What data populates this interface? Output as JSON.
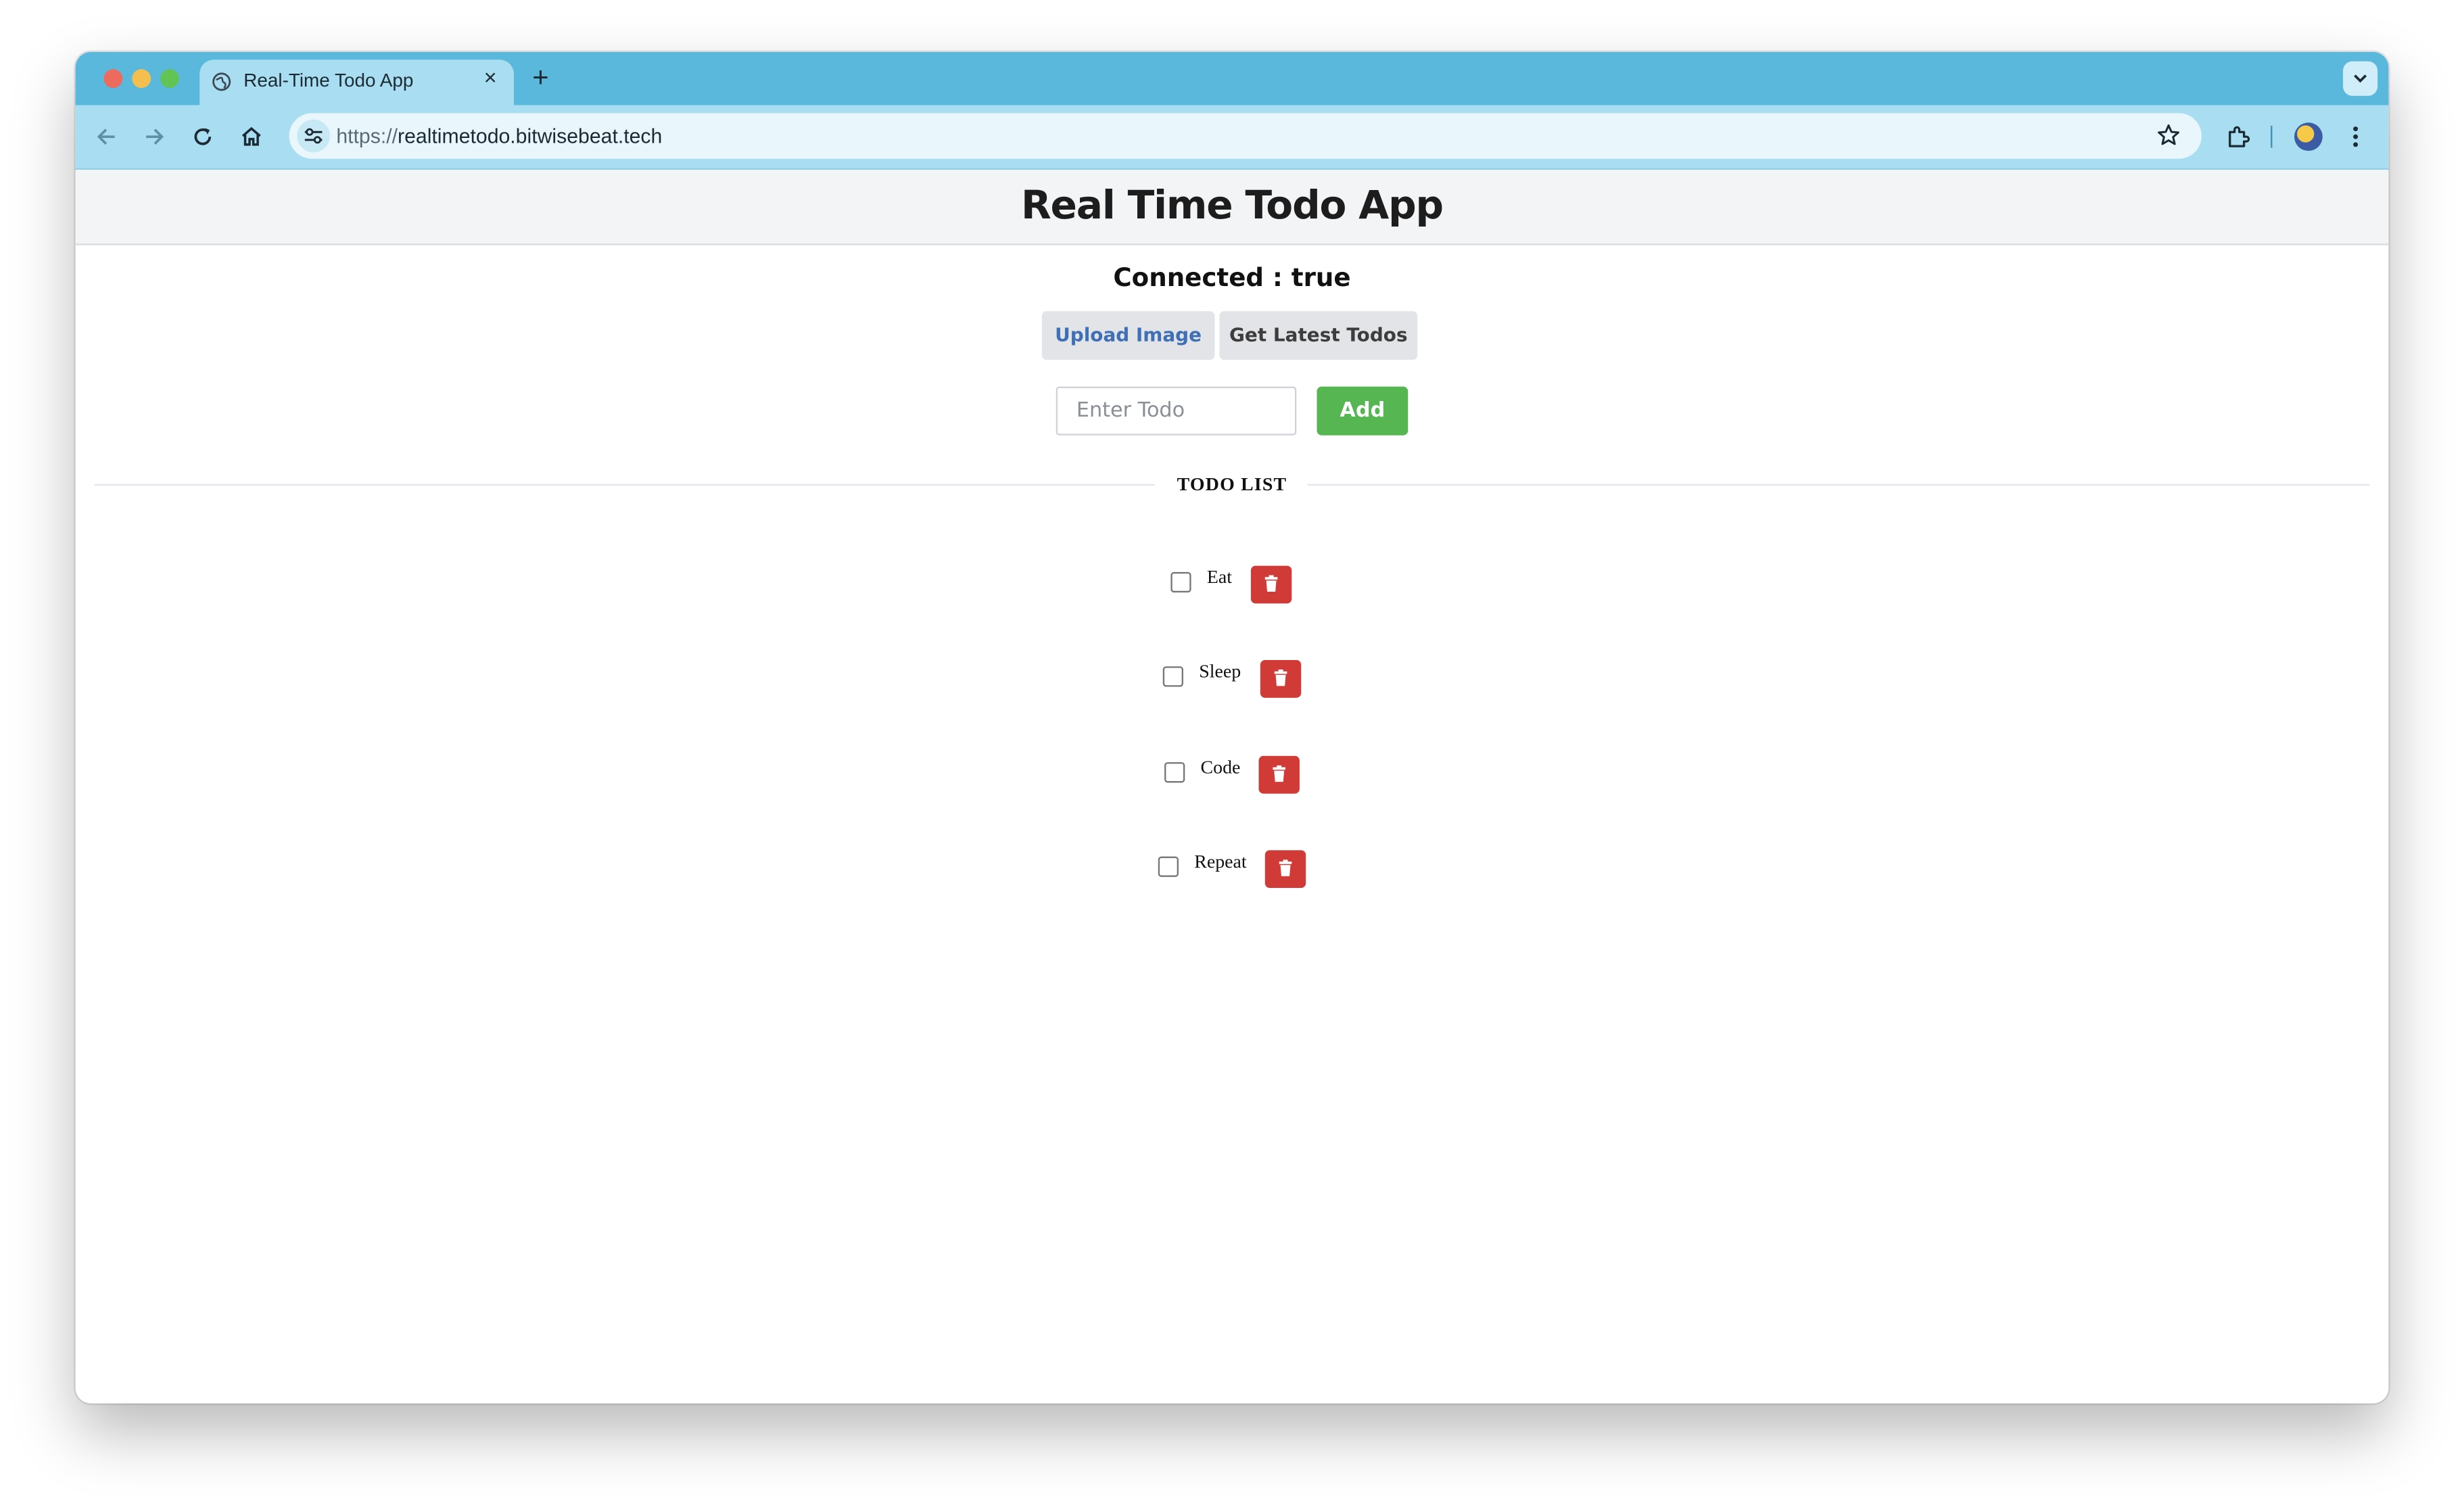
{
  "browser": {
    "tab_title": "Real-Time Todo App",
    "tab_close": "×",
    "new_tab": "+",
    "url_scheme": "https://",
    "url_host": "realtimetodo.bitwisebeat.tech"
  },
  "app": {
    "title": "Real Time Todo App",
    "status": "Connected : true",
    "buttons": {
      "upload_image": "Upload Image",
      "get_latest": "Get Latest Todos",
      "add": "Add"
    },
    "input": {
      "placeholder": "Enter Todo",
      "value": ""
    },
    "list_title": "TODO LIST",
    "todos": [
      {
        "label": "Eat",
        "checked": false
      },
      {
        "label": "Sleep",
        "checked": false
      },
      {
        "label": "Code",
        "checked": false
      },
      {
        "label": "Repeat",
        "checked": false
      }
    ]
  },
  "icons": {
    "tab": "globe-icon",
    "toolbar": [
      "back-arrow-icon",
      "forward-arrow-icon",
      "reload-icon",
      "home-icon",
      "site-settings-icon",
      "bookmark-star-icon",
      "extensions-icon",
      "profile-avatar",
      "kebab-menu-icon"
    ],
    "todo_delete": "trash-icon"
  },
  "colors": {
    "tab_strip": "#5ab8dc",
    "toolbar": "#a9ddf1",
    "add_button": "#56b651",
    "delete_button": "#d13b37",
    "upload_text": "#3f6fb5"
  }
}
